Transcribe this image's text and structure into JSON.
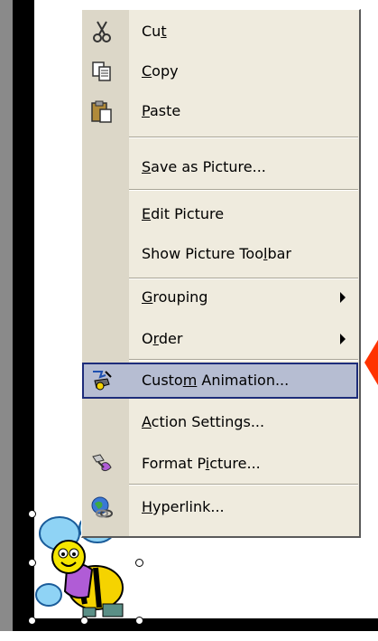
{
  "context_menu": {
    "items": [
      {
        "id": "cut",
        "pre": "Cu",
        "key": "t",
        "post": "",
        "icon": "scissors-icon"
      },
      {
        "id": "copy",
        "pre": "",
        "key": "C",
        "post": "opy",
        "icon": "copy-icon"
      },
      {
        "id": "paste",
        "pre": "",
        "key": "P",
        "post": "aste",
        "icon": "paste-icon"
      },
      {
        "id": "save-as-picture",
        "pre": "",
        "key": "S",
        "post": "ave as Picture..."
      },
      {
        "id": "edit-picture",
        "pre": "",
        "key": "E",
        "post": "dit Picture"
      },
      {
        "id": "show-picture-toolbar",
        "pre": "Show Picture Too",
        "key": "l",
        "post": "bar"
      },
      {
        "id": "grouping",
        "pre": "",
        "key": "G",
        "post": "rouping",
        "submenu": true
      },
      {
        "id": "order",
        "pre": "O",
        "key": "r",
        "post": "der",
        "submenu": true
      },
      {
        "id": "custom-animation",
        "pre": "Custo",
        "key": "m",
        "post": " Animation...",
        "icon": "custom-animation-icon",
        "highlighted": true
      },
      {
        "id": "action-settings",
        "pre": "",
        "key": "A",
        "post": "ction Settings..."
      },
      {
        "id": "format-picture",
        "pre": "Format P",
        "key": "i",
        "post": "cture...",
        "icon": "format-picture-icon"
      },
      {
        "id": "hyperlink",
        "pre": "",
        "key": "H",
        "post": "yperlink...",
        "icon": "hyperlink-icon"
      }
    ]
  },
  "colors": {
    "menu_background": "#efebde",
    "highlight_fill": "#b6bdd2",
    "highlight_border": "#1d2c7a",
    "pointer_arrow": "#ff3300"
  }
}
